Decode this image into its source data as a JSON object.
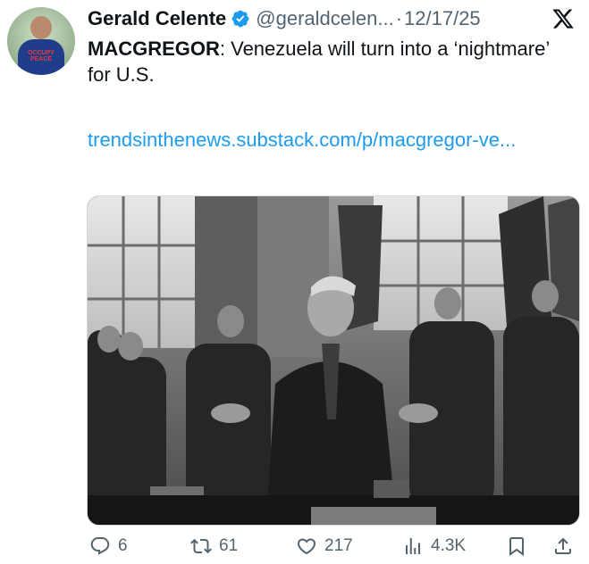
{
  "author": {
    "display_name": "Gerald Celente",
    "handle": "@geraldcelen...",
    "verified": true,
    "avatar_shirt_text": "OCCUPY PEACE",
    "avatar_shirt_highlight": "X"
  },
  "post": {
    "separator": "·",
    "date": "12/17/25",
    "headline_bold": "MACGREGOR",
    "headline_rest": ": Venezuela will turn into a ‘nightmare’ for U.S.",
    "link_text": "trendsinthenews.substack.com/p/macgregor-ve..."
  },
  "actions": {
    "replies": "6",
    "reposts": "61",
    "likes": "217",
    "views": "4.3K"
  },
  "colors": {
    "link": "#1d9bf0",
    "verified": "#1d9bf0",
    "muted": "#536471",
    "text": "#0f1419"
  },
  "icons": [
    "verified-badge-icon",
    "x-logo-icon",
    "reply-icon",
    "repost-icon",
    "like-icon",
    "views-icon",
    "bookmark-icon",
    "share-icon"
  ]
}
